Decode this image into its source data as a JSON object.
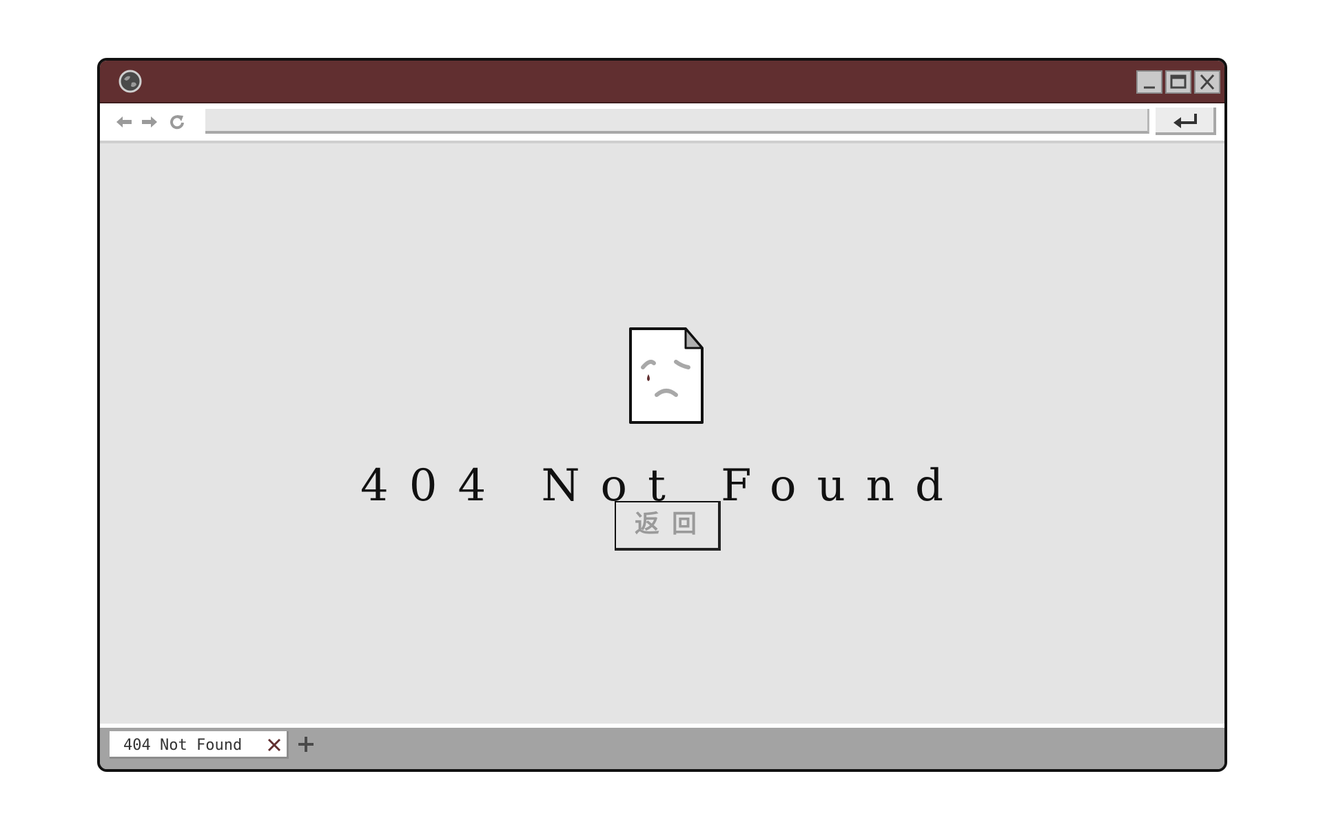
{
  "window": {
    "title_bar_color": "#612f30",
    "address_value": "",
    "controls": [
      "minimize-icon",
      "maximize-icon",
      "close-icon"
    ]
  },
  "toolbar": {
    "icons": [
      "arrow-left-icon",
      "arrow-right-icon",
      "reload-icon",
      "enter-icon"
    ]
  },
  "main": {
    "error_title": "404 Not Found",
    "return_button_label": "返回",
    "icon": "sad-document-icon"
  },
  "tabs": [
    {
      "label": "404 Not Found",
      "close_icon": "close-icon"
    }
  ],
  "new_tab_icon": "plus-icon",
  "colors": {
    "accent": "#612f30",
    "content_background": "#e4e4e4",
    "tab_bar": "#a3a3a3"
  }
}
